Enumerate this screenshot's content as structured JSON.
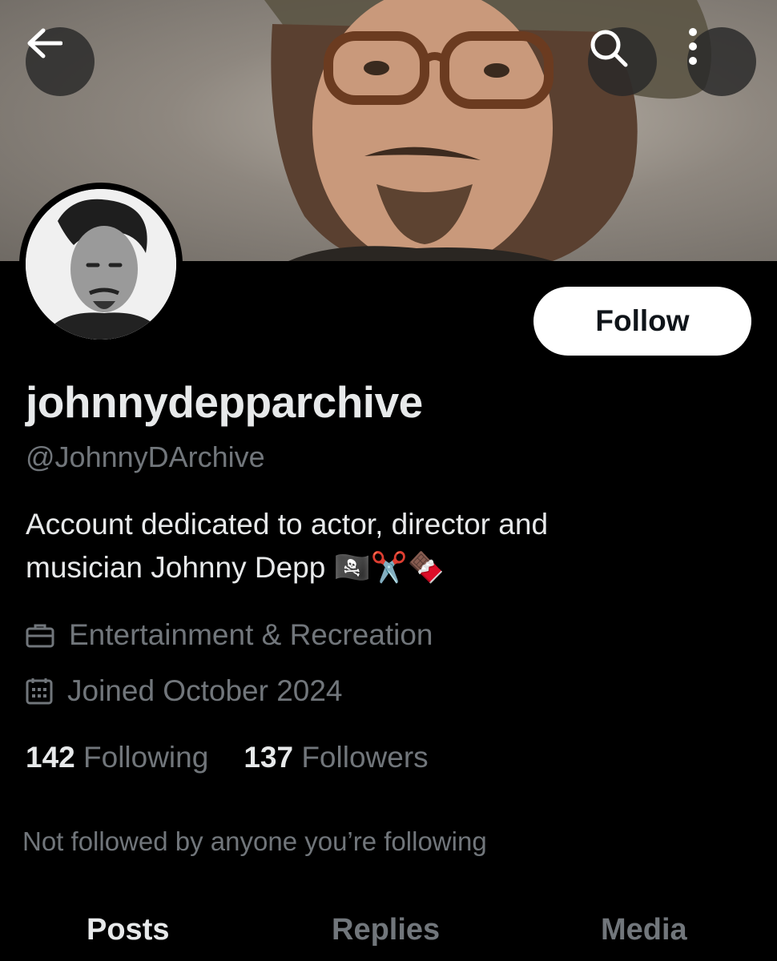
{
  "banner": {
    "image": "johnny-depp-portrait-with-glasses-and-hat"
  },
  "top_bar": {
    "back_icon": "arrow-left-icon",
    "search_icon": "search-icon",
    "more_icon": "more-vertical-icon"
  },
  "profile": {
    "avatar": "johnny-depp-black-and-white-portrait",
    "display_name": "johnnydepparchive",
    "handle": "@JohnnyDArchive",
    "bio_line1": "Account dedicated to actor, director and",
    "bio_line2": "musician Johnny Depp",
    "bio_emojis": "🏴‍☠️✂️🍫",
    "category": "Entertainment & Recreation",
    "joined": "Joined October 2024"
  },
  "actions": {
    "follow_label": "Follow"
  },
  "stats": {
    "following_count": "142",
    "following_label": "Following",
    "followers_count": "137",
    "followers_label": "Followers"
  },
  "social_context": "Not followed by anyone you’re following",
  "tabs": [
    {
      "label": "Posts",
      "active": true
    },
    {
      "label": "Replies",
      "active": false
    },
    {
      "label": "Media",
      "active": false
    }
  ],
  "colors": {
    "background": "#000000",
    "text": "#e7e9ea",
    "secondary": "#71767b",
    "button": "#ffffff"
  }
}
